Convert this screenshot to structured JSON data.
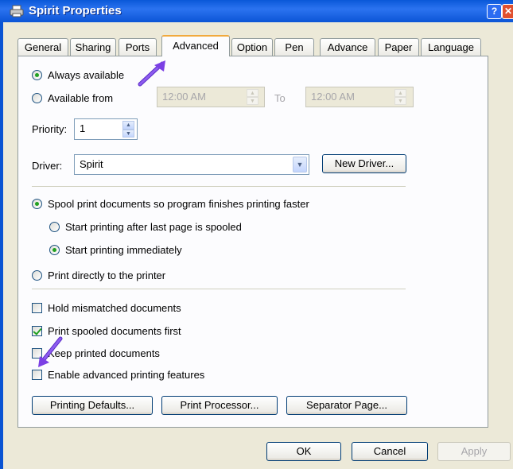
{
  "window": {
    "title": "Spirit Properties",
    "help_label": "?",
    "close_label": "✕"
  },
  "tabs": [
    {
      "label": "General"
    },
    {
      "label": "Sharing"
    },
    {
      "label": "Ports"
    },
    {
      "label": "Advanced",
      "active": true
    },
    {
      "label": "Option"
    },
    {
      "label": "Pen"
    },
    {
      "label": "Advance"
    },
    {
      "label": "Paper"
    },
    {
      "label": "Language"
    }
  ],
  "availability": {
    "always_label": "Always available",
    "from_label": "Available from",
    "from_time": "12:00 AM",
    "to_label": "To",
    "to_time": "12:00 AM",
    "selected": "always"
  },
  "priority": {
    "label": "Priority:",
    "value": "1"
  },
  "driver": {
    "label": "Driver:",
    "value": "Spirit",
    "new_driver_label": "New Driver..."
  },
  "spool": {
    "spool_label": "Spool print documents so program finishes printing faster",
    "after_last_page_label": "Start printing after last page is spooled",
    "immediately_label": "Start printing immediately",
    "direct_label": "Print directly to the printer"
  },
  "options": {
    "hold_mismatched_label": "Hold mismatched documents",
    "hold_mismatched_checked": false,
    "print_spooled_first_label": "Print spooled documents first",
    "print_spooled_first_checked": true,
    "keep_printed_label": "Keep printed documents",
    "keep_printed_checked": false,
    "advanced_features_label": "Enable advanced printing features",
    "advanced_features_checked": false
  },
  "buttons": {
    "printing_defaults": "Printing Defaults...",
    "print_processor": "Print Processor...",
    "separator_page": "Separator Page...",
    "ok": "OK",
    "cancel": "Cancel",
    "apply": "Apply"
  },
  "colors": {
    "titlebar": "#0a58d8",
    "annotation_arrow": "#7b3fe4",
    "checkmark": "#21a121"
  }
}
